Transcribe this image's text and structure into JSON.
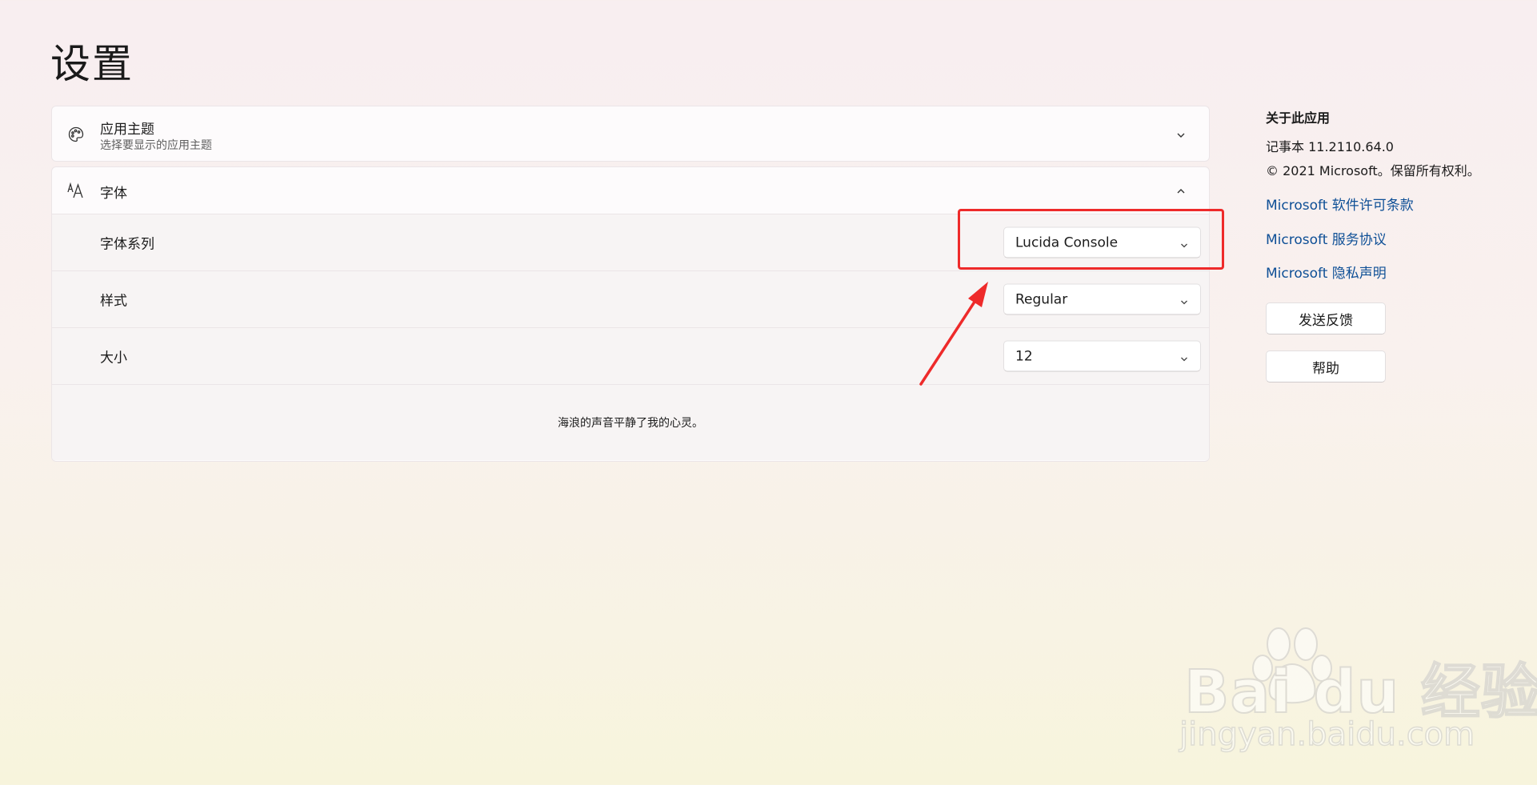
{
  "page": {
    "title": "设置"
  },
  "theme_card": {
    "title": "应用主题",
    "subtitle": "选择要显示的应用主题",
    "icon": "palette-icon",
    "expanded": false
  },
  "font_card": {
    "title": "字体",
    "icon": "font-size-icon",
    "expanded": true,
    "rows": [
      {
        "label": "字体系列",
        "value": "Lucida Console"
      },
      {
        "label": "样式",
        "value": "Regular"
      },
      {
        "label": "大小",
        "value": "12"
      }
    ],
    "preview_text": "海浪的声音平静了我的心灵。"
  },
  "about": {
    "heading": "关于此应用",
    "version": "记事本 11.2110.64.0",
    "copyright": "© 2021 Microsoft。保留所有权利。",
    "links": [
      "Microsoft 软件许可条款",
      "Microsoft 服务协议",
      "Microsoft 隐私声明"
    ],
    "buttons": {
      "feedback": "发送反馈",
      "help": "帮助"
    }
  },
  "annotation": {
    "color": "#ee2a2a",
    "highlights": "font-family-dropdown"
  },
  "watermark": {
    "main": "Bai du 经验",
    "sub": "jingyan.baidu.com"
  },
  "colors": {
    "link": "#0e4f96",
    "card_background": "#fdfbfc",
    "row_background": "#f7f4f4"
  }
}
